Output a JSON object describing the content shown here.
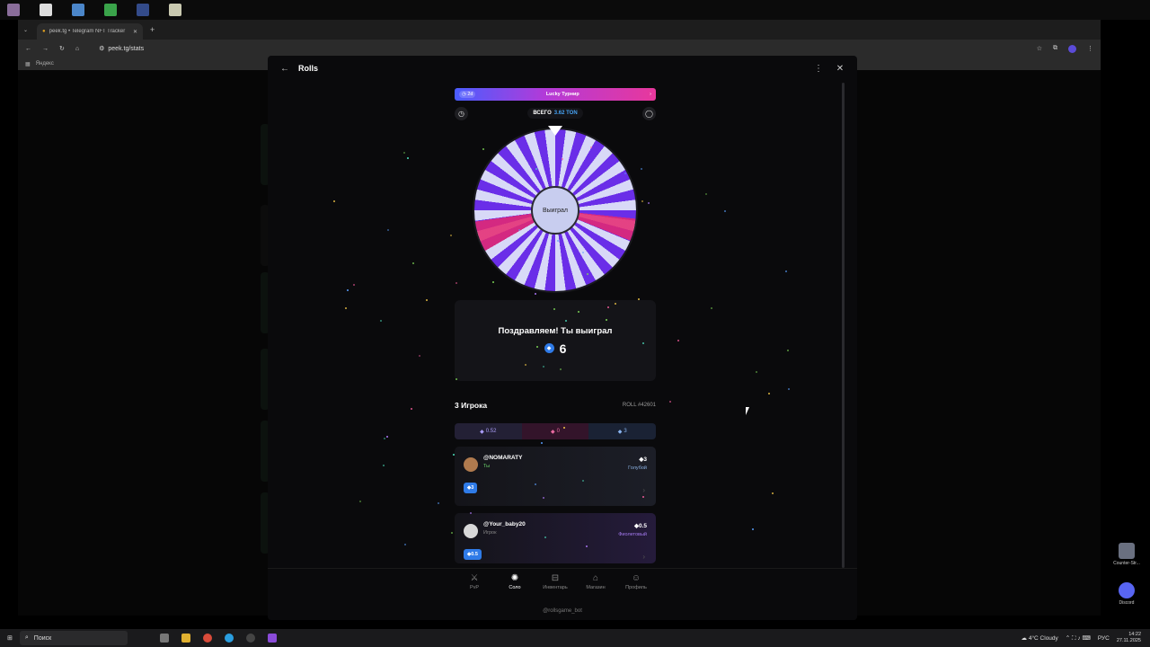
{
  "browser": {
    "tab_title": "peek.tg • Telegram NFT Tracker",
    "url": "peek.tg/stats",
    "bookmark": "Яндекс"
  },
  "modal": {
    "title": "Rolls",
    "banner": {
      "timer": "2d",
      "label": "Lucky Турнир"
    },
    "total_label": "ВСЕГО",
    "total_value": "3.62 TON",
    "wheel_center": "Выиграл",
    "win_title": "Поздравляем! Ты выиграл",
    "win_amount": "6",
    "players_title": "3 Игрока",
    "roll_id": "ROLL #42601",
    "bets": [
      "0.52",
      "0",
      "3"
    ],
    "players": [
      {
        "name": "@NOMARATY",
        "sub": "Ты",
        "amount": "3",
        "color": "Голубой",
        "chip": "3"
      },
      {
        "name": "@Your_baby20",
        "sub": "Игрок",
        "amount": "0.5",
        "color": "Фиолетовый",
        "chip": "0.5"
      }
    ],
    "nav": [
      {
        "label": "PvP",
        "icon": "swords-icon"
      },
      {
        "label": "Соло",
        "icon": "wheel-icon"
      },
      {
        "label": "Инвентарь",
        "icon": "inventory-icon"
      },
      {
        "label": "Магазин",
        "icon": "shop-icon"
      },
      {
        "label": "Профиль",
        "icon": "profile-icon"
      }
    ],
    "bot_name": "@rollsgame_bot"
  },
  "desktop": {
    "right_icons": [
      "Counter-Str...",
      "Discord"
    ]
  },
  "taskbar": {
    "search": "Поиск",
    "weather": "4°C  Cloudy",
    "lang": "РУС",
    "time": "14:22",
    "date": "27.11.2025"
  },
  "colors": {
    "accent_blue": "#2f7be8",
    "wheel_purple": "#6a2ee8",
    "wheel_pink": "#e6286f"
  }
}
